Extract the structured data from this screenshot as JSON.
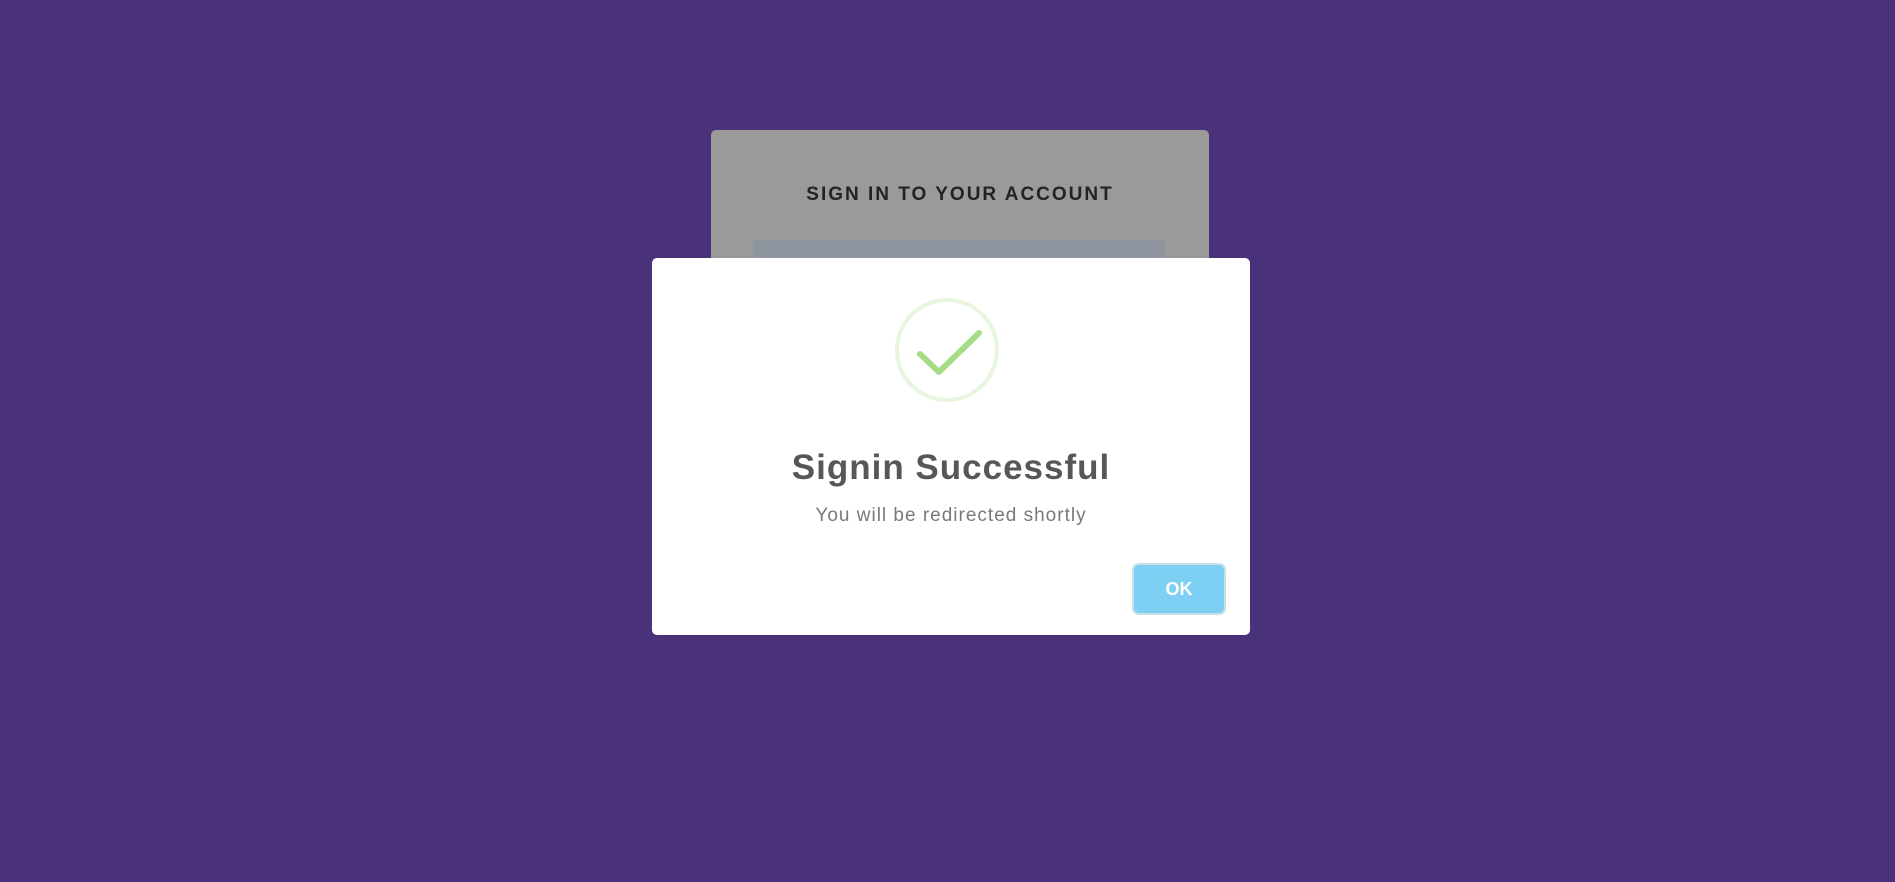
{
  "background_color": "#4a327b",
  "login_card": {
    "title": "SIGN IN TO YOUR ACCOUNT"
  },
  "modal": {
    "icon": "checkmark-success-icon",
    "icon_color": "#a5dc86",
    "title": "Signin Successful",
    "text": "You will be redirected shortly",
    "ok_label": "OK",
    "ok_color": "#7ecff4"
  }
}
